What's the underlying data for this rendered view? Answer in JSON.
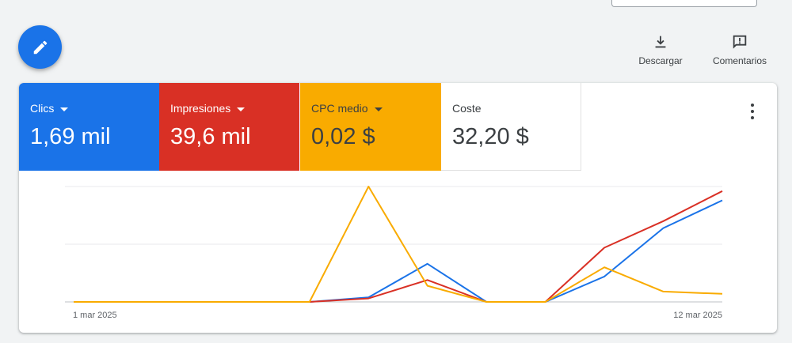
{
  "toolbar": {
    "download_label": "Descargar",
    "feedback_label": "Comentarios",
    "fab_icon": "pencil-icon"
  },
  "metrics": [
    {
      "label": "Clics",
      "value": "1,69 mil",
      "color": "#1a73e8",
      "has_dropdown": true
    },
    {
      "label": "Impresiones",
      "value": "39,6 mil",
      "color": "#d93025",
      "has_dropdown": true
    },
    {
      "label": "CPC medio",
      "value": "0,02 $",
      "color": "#f9ab00",
      "has_dropdown": true
    },
    {
      "label": "Coste",
      "value": "32,20 $",
      "color": "#ffffff",
      "has_dropdown": false
    }
  ],
  "chart_data": {
    "type": "line",
    "x_start_label": "1 mar 2025",
    "x_end_label": "12 mar 2025",
    "grid": true,
    "normalized_scale": true,
    "series": [
      {
        "metric": "Clics",
        "color": "#1a73e8",
        "values": [
          0,
          0,
          0,
          0,
          0,
          0.04,
          0.33,
          0,
          0,
          0.22,
          0.64,
          0.88
        ]
      },
      {
        "metric": "Impresiones",
        "color": "#d93025",
        "values": [
          0,
          0,
          0,
          0,
          0,
          0.03,
          0.19,
          0,
          0,
          0.47,
          0.7,
          0.96
        ]
      },
      {
        "metric": "CPC medio",
        "color": "#f9ab00",
        "values": [
          0,
          0,
          0,
          0,
          0,
          1.0,
          0.14,
          0,
          0,
          0.3,
          0.09,
          0.07
        ]
      }
    ]
  }
}
